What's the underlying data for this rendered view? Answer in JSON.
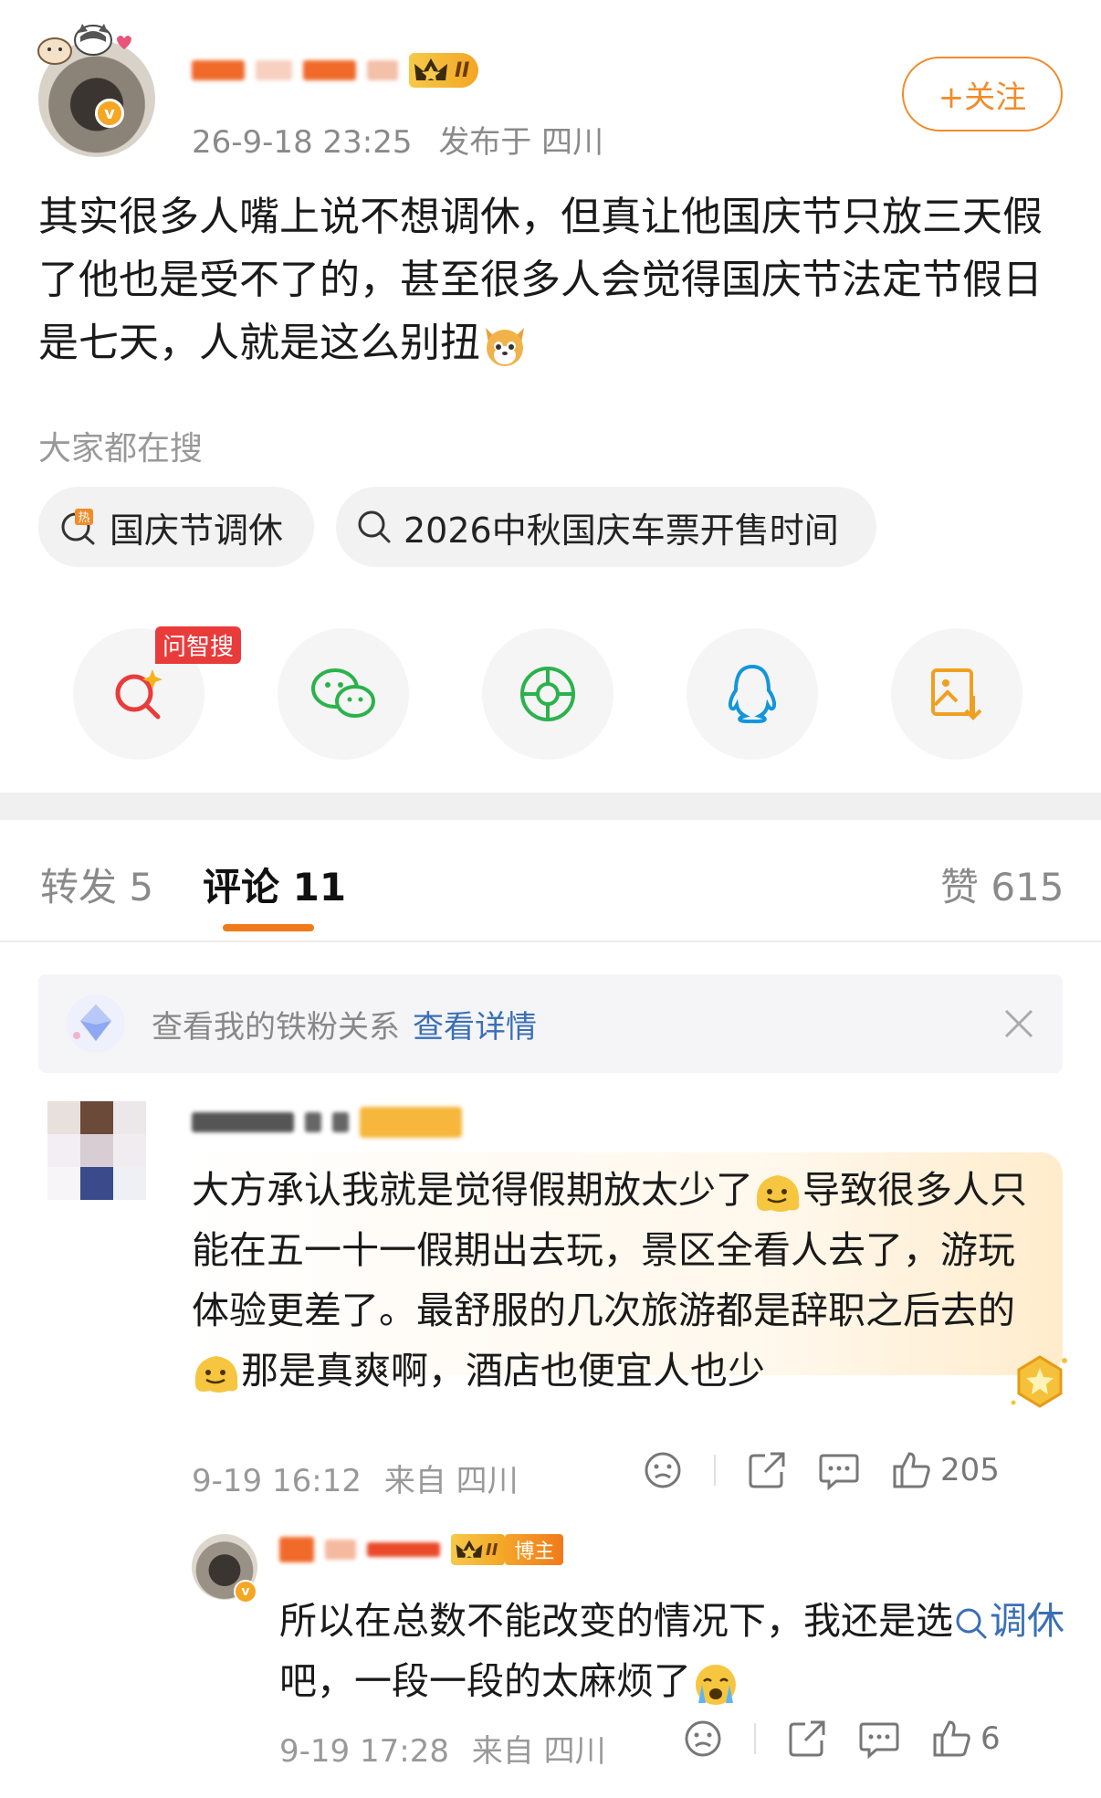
{
  "post": {
    "time": "26-9-18 23:25",
    "location": "发布于 四川",
    "level_badge": "II",
    "follow_label": "+关注",
    "content": "其实很多人嘴上说不想调休，但真让他国庆节只放三天假了他也是受不了的，甚至很多人会觉得国庆节法定节假日是七天，人就是这么别扭",
    "content_emoji": "dog-face-emoji"
  },
  "search": {
    "label": "大家都在搜",
    "pills": [
      {
        "text": "国庆节调休",
        "icon": "hot-search-icon"
      },
      {
        "text": "2026中秋国庆车票开售时间",
        "icon": "search-icon"
      }
    ]
  },
  "share": {
    "ask_tag": "问智搜",
    "items": [
      "ask-search-icon",
      "wechat-icon",
      "moments-icon",
      "qq-icon",
      "save-image-icon"
    ]
  },
  "tabs": {
    "repost": "转发 5",
    "comments": "评论 11",
    "likes": "赞 615"
  },
  "fan_banner": {
    "text": "查看我的铁粉关系",
    "link": "查看详情"
  },
  "comment": {
    "text_a": "大方承认我就是觉得假期放太少了",
    "text_b": "导致很多人只能在五一十一假期出去玩，景区全看人去了，游玩体验更差了。最舒服的几次旅游都是辞职之后去的",
    "text_c": "那是真爽啊，酒店也便宜人也少",
    "time": "9-19 16:12",
    "location": "来自 四川",
    "like_count": "205"
  },
  "reply": {
    "host_tag": "博主",
    "level_badge": "II",
    "text_a": "所以在总数不能改变的情况下，我还是选",
    "link_text": "调休",
    "text_b": "吧，一段一段的太麻烦了",
    "time": "9-19 17:28",
    "location": "来自 四川",
    "like_count": "6"
  },
  "colors": {
    "accent_orange": "#f08c2a",
    "link_blue": "#3b6fb6",
    "ask_red": "#ea3b3b"
  }
}
